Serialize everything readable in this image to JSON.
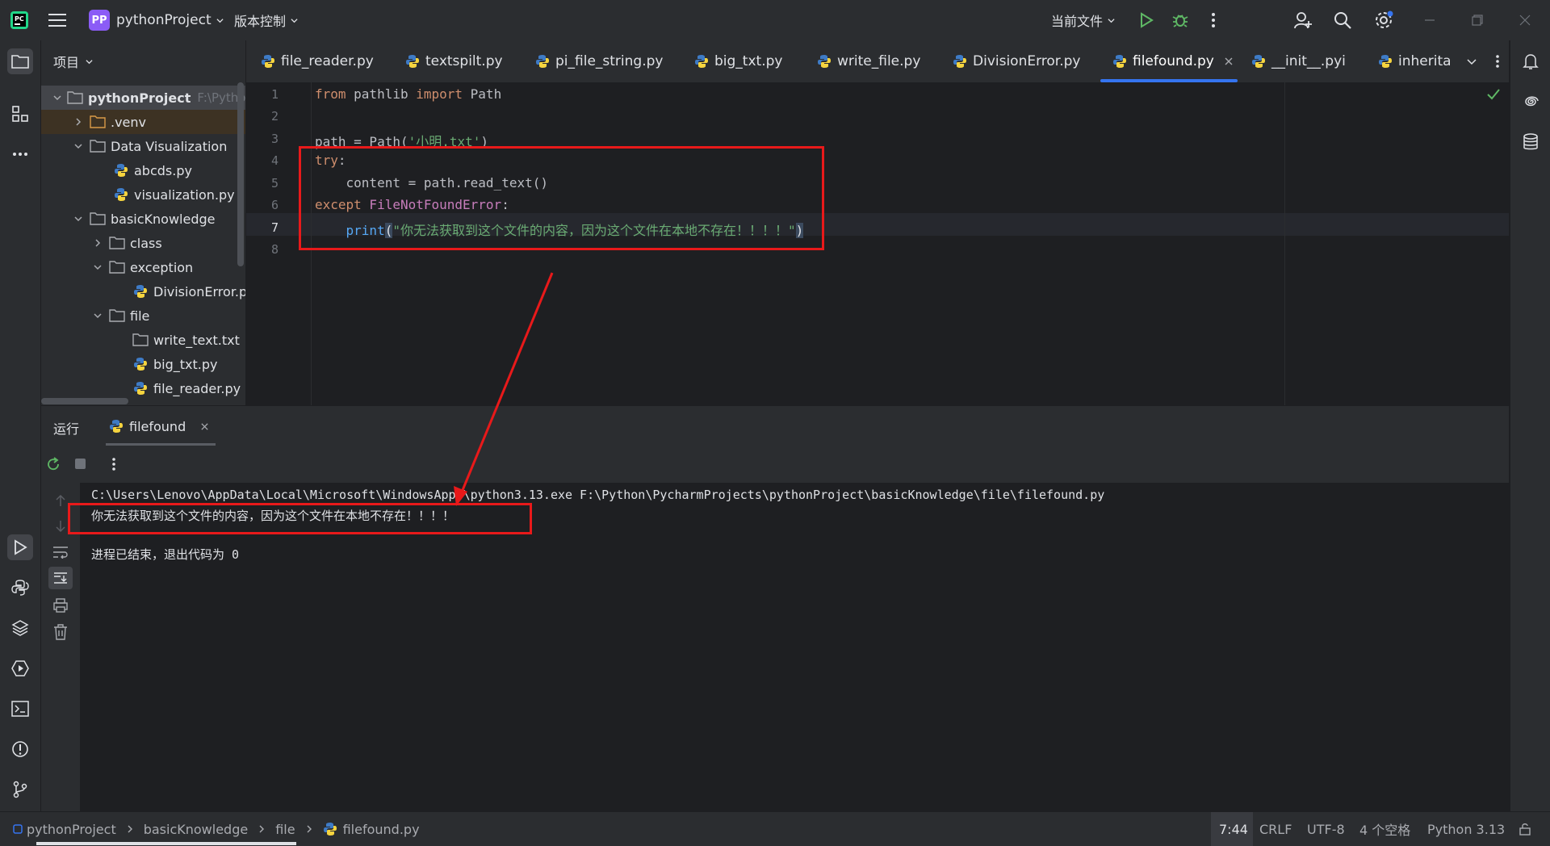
{
  "titlebar": {
    "project_badge": "PP",
    "project_name": "pythonProject",
    "vcs": "版本控制",
    "run_config": "当前文件"
  },
  "project_panel": {
    "title": "项目",
    "tree": [
      {
        "label": "pythonProject",
        "suffix": "F:\\Pytho",
        "type": "root"
      },
      {
        "label": ".venv",
        "type": "folder"
      },
      {
        "label": "Data Visualization",
        "type": "folder"
      },
      {
        "label": "abcds.py",
        "type": "py"
      },
      {
        "label": "visualization.py",
        "type": "py"
      },
      {
        "label": "basicKnowledge",
        "type": "folder"
      },
      {
        "label": "class",
        "type": "folder"
      },
      {
        "label": "exception",
        "type": "folder"
      },
      {
        "label": "DivisionError.py",
        "type": "py"
      },
      {
        "label": "file",
        "type": "folder"
      },
      {
        "label": "write_text.txt",
        "type": "file"
      },
      {
        "label": "big_txt.py",
        "type": "py"
      },
      {
        "label": "file_reader.py",
        "type": "py"
      }
    ]
  },
  "tabs": [
    {
      "label": "file_reader.py"
    },
    {
      "label": "textspilt.py"
    },
    {
      "label": "pi_file_string.py"
    },
    {
      "label": "big_txt.py"
    },
    {
      "label": "write_file.py"
    },
    {
      "label": "DivisionError.py"
    },
    {
      "label": "filefound.py",
      "active": true
    },
    {
      "label": "__init__.pyi"
    },
    {
      "label": "inherita"
    }
  ],
  "editor": {
    "line_numbers": [
      "1",
      "2",
      "3",
      "4",
      "5",
      "6",
      "7",
      "8"
    ],
    "current_line": 7,
    "code": {
      "l1_from": "from",
      "l1_mod": " pathlib ",
      "l1_import": "import",
      "l1_name": " Path",
      "l3_a": "path = Path(",
      "l3_str": "'小明.txt'",
      "l3_b": ")",
      "l4_try": "try",
      "l4_colon": ":",
      "l5": "    content = path.read_text()",
      "l6_except": "except",
      "l6_cls": " FileNotFoundError",
      "l6_colon": ":",
      "l7_indent": "    ",
      "l7_print": "print",
      "l7_open": "(",
      "l7_str": "\"你无法获取到这个文件的内容，因为这个文件在本地不存在！！！！\"",
      "l7_close": ")"
    }
  },
  "run": {
    "title": "运行",
    "tab": "filefound",
    "console": [
      "C:\\Users\\Lenovo\\AppData\\Local\\Microsoft\\WindowsApps\\python3.13.exe F:\\Python\\PycharmProjects\\pythonProject\\basicKnowledge\\file\\filefound.py",
      "你无法获取到这个文件的内容，因为这个文件在本地不存在！！！！",
      "",
      "进程已结束，退出代码为 0"
    ]
  },
  "statusbar": {
    "breadcrumb": [
      "pythonProject",
      "basicKnowledge",
      "file",
      "filefound.py"
    ],
    "position": "7:44",
    "line_sep": "CRLF",
    "encoding": "UTF-8",
    "indent": "4 个空格",
    "interpreter": "Python 3.13"
  },
  "colors": {
    "accent": "#3574f0",
    "annotation": "#e8191a",
    "run_green": "#5fb865"
  }
}
